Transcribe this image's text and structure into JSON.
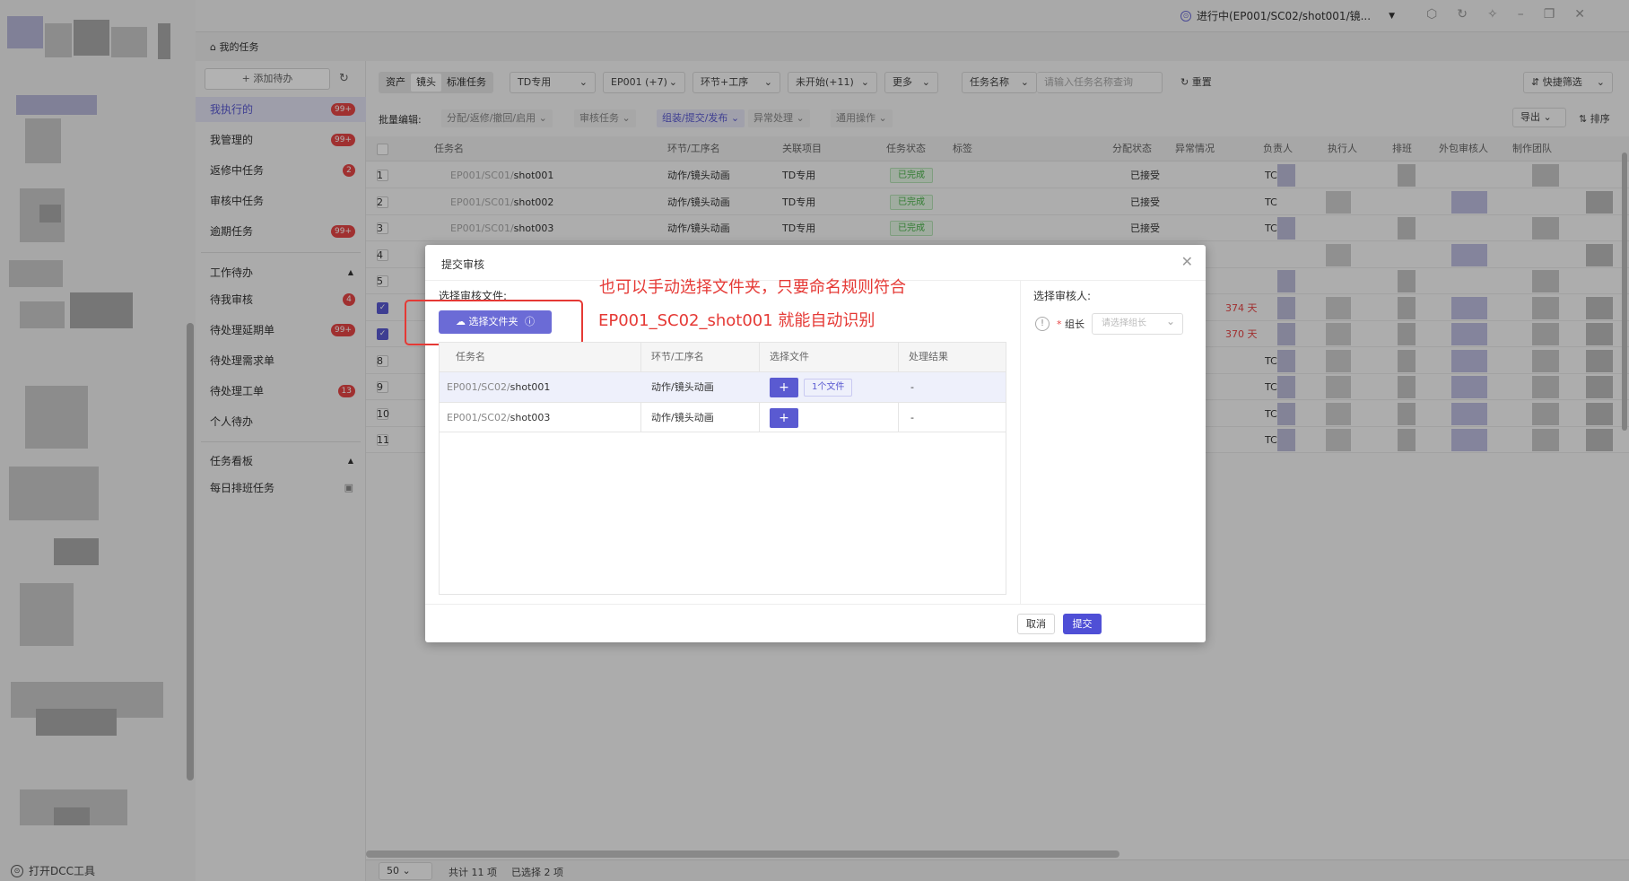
{
  "topbar": {
    "status_label": "进行中(EP001/SC02/shot001/镜...",
    "status_icon": "status-dot-icon",
    "controls": [
      "cube-icon",
      "refresh-icon",
      "pin-icon",
      "minimize-icon",
      "restore-icon",
      "close-icon"
    ]
  },
  "breadcrumb": {
    "label": "我的任务",
    "icon": "home-icon"
  },
  "rail": {
    "footer_label": "打开DCC工具"
  },
  "nav": {
    "add_label": "+ 添加待办",
    "items": [
      {
        "label": "我执行的",
        "badge": "99+"
      },
      {
        "label": "我管理的",
        "badge": "99+"
      },
      {
        "label": "返修中任务",
        "badge": "2"
      },
      {
        "label": "审核中任务",
        "badge": ""
      },
      {
        "label": "逾期任务",
        "badge": "99+"
      }
    ],
    "group_work": "工作待办",
    "work_items": [
      {
        "label": "待我审核",
        "badge": "4"
      },
      {
        "label": "待处理延期单",
        "badge": "99+"
      },
      {
        "label": "待处理需求单",
        "badge": ""
      },
      {
        "label": "待处理工单",
        "badge": "13"
      },
      {
        "label": "个人待办",
        "badge": ""
      }
    ],
    "group_board": "任务看板",
    "board_items": [
      {
        "label": "每日排班任务"
      }
    ]
  },
  "toolbar": {
    "seg": [
      "资产",
      "镜头",
      "标准任务"
    ],
    "filters": [
      "TD专用",
      "EP001 (+7)",
      "环节+工序",
      "未开始(+11)",
      "更多",
      "任务名称"
    ],
    "search_placeholder": "请输入任务名称查询",
    "reset_label": "重置",
    "quick_filter": "快捷筛选"
  },
  "batch": {
    "label": "批量编辑:",
    "items": [
      "分配/返修/撤回/启用",
      "审核任务",
      "组装/提交/发布",
      "异常处理",
      "通用操作"
    ],
    "export_label": "导出",
    "sort_label": "排序"
  },
  "table": {
    "headers": [
      "任务名",
      "环节/工序名",
      "关联项目",
      "任务状态",
      "标签",
      "分配状态",
      "异常情况",
      "负责人",
      "执行人",
      "排班",
      "外包审核人",
      "制作团队"
    ],
    "rows": [
      {
        "no": "1",
        "prefix": "EP001/SC01/",
        "shot": "shot001",
        "step": "动作/镜头动画",
        "project": "TD专用",
        "status": "已完成",
        "assign": "已接受",
        "extra": "",
        "owner": "TC"
      },
      {
        "no": "2",
        "prefix": "EP001/SC01/",
        "shot": "shot002",
        "step": "动作/镜头动画",
        "project": "TD专用",
        "status": "已完成",
        "assign": "已接受",
        "extra": "",
        "owner": "TC"
      },
      {
        "no": "3",
        "prefix": "EP001/SC01/",
        "shot": "shot003",
        "step": "动作/镜头动画",
        "project": "TD专用",
        "status": "已完成",
        "assign": "已接受",
        "extra": "",
        "owner": "TC"
      },
      {
        "no": "4",
        "prefix": "",
        "shot": "",
        "step": "",
        "project": "",
        "status": "",
        "assign": "",
        "extra": "",
        "owner": ""
      },
      {
        "no": "5",
        "prefix": "",
        "shot": "",
        "step": "",
        "project": "",
        "status": "",
        "assign": "",
        "extra": "",
        "owner": ""
      },
      {
        "no": "",
        "prefix": "",
        "shot": "",
        "step": "",
        "project": "",
        "status": "",
        "assign": "",
        "extra": "374 天",
        "owner": ""
      },
      {
        "no": "",
        "prefix": "",
        "shot": "",
        "step": "",
        "project": "",
        "status": "",
        "assign": "",
        "extra": "370 天",
        "owner": ""
      },
      {
        "no": "8",
        "prefix": "",
        "shot": "",
        "step": "",
        "project": "",
        "status": "",
        "assign": "",
        "extra": "",
        "owner": "TC"
      },
      {
        "no": "9",
        "prefix": "",
        "shot": "",
        "step": "",
        "project": "",
        "status": "",
        "assign": "",
        "extra": "",
        "owner": "TC"
      },
      {
        "no": "10",
        "prefix": "",
        "shot": "",
        "step": "",
        "project": "",
        "status": "",
        "assign": "",
        "extra": "",
        "owner": "TC"
      },
      {
        "no": "11",
        "prefix": "",
        "shot": "",
        "step": "",
        "project": "",
        "status": "",
        "assign": "",
        "extra": "",
        "owner": "TC"
      }
    ]
  },
  "footer": {
    "page_size": "50",
    "total": "共计 11 项",
    "selected": "已选择 2 项"
  },
  "modal": {
    "title": "提交审核",
    "select_files_title": "选择审核文件:",
    "select_folder_label": "选择文件夹",
    "columns": [
      "任务名",
      "环节/工序名",
      "选择文件",
      "处理结果"
    ],
    "rows": [
      {
        "prefix": "EP001/SC02/",
        "shot": "shot001",
        "step": "动作/镜头动画",
        "plus": "+",
        "file": "1个文件",
        "result": "-"
      },
      {
        "prefix": "EP001/SC02/",
        "shot": "shot003",
        "step": "动作/镜头动画",
        "plus": "+",
        "file": "",
        "result": "-"
      }
    ],
    "reviewer_title": "选择审核人:",
    "reviewer_label": "组长",
    "reviewer_required": "*",
    "reviewer_placeholder": "请选择组长",
    "cancel_label": "取消",
    "submit_label": "提交"
  },
  "annotations": {
    "line1": "也可以手动选择文件夹，只要命名规则符合",
    "line2": "EP001_SC02_shot001 就能自动识别",
    "color": "#e53935"
  }
}
